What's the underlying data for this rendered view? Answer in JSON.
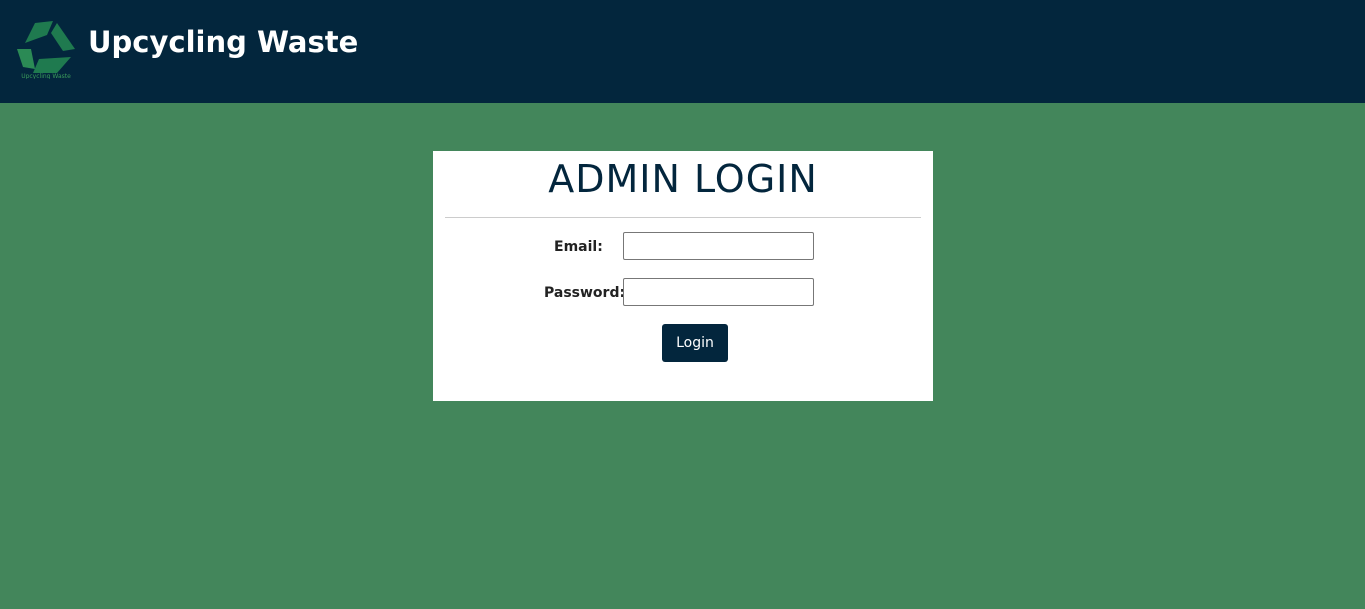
{
  "header": {
    "title": "Upcycling Waste",
    "logo_text": "Upcycling Waste"
  },
  "login": {
    "title": "ADMIN LOGIN",
    "email_label": "Email:",
    "email_value": "",
    "password_label": "Password:",
    "password_value": "",
    "button": "Login"
  },
  "colors": {
    "header": "#03263d",
    "background": "#43865b"
  }
}
